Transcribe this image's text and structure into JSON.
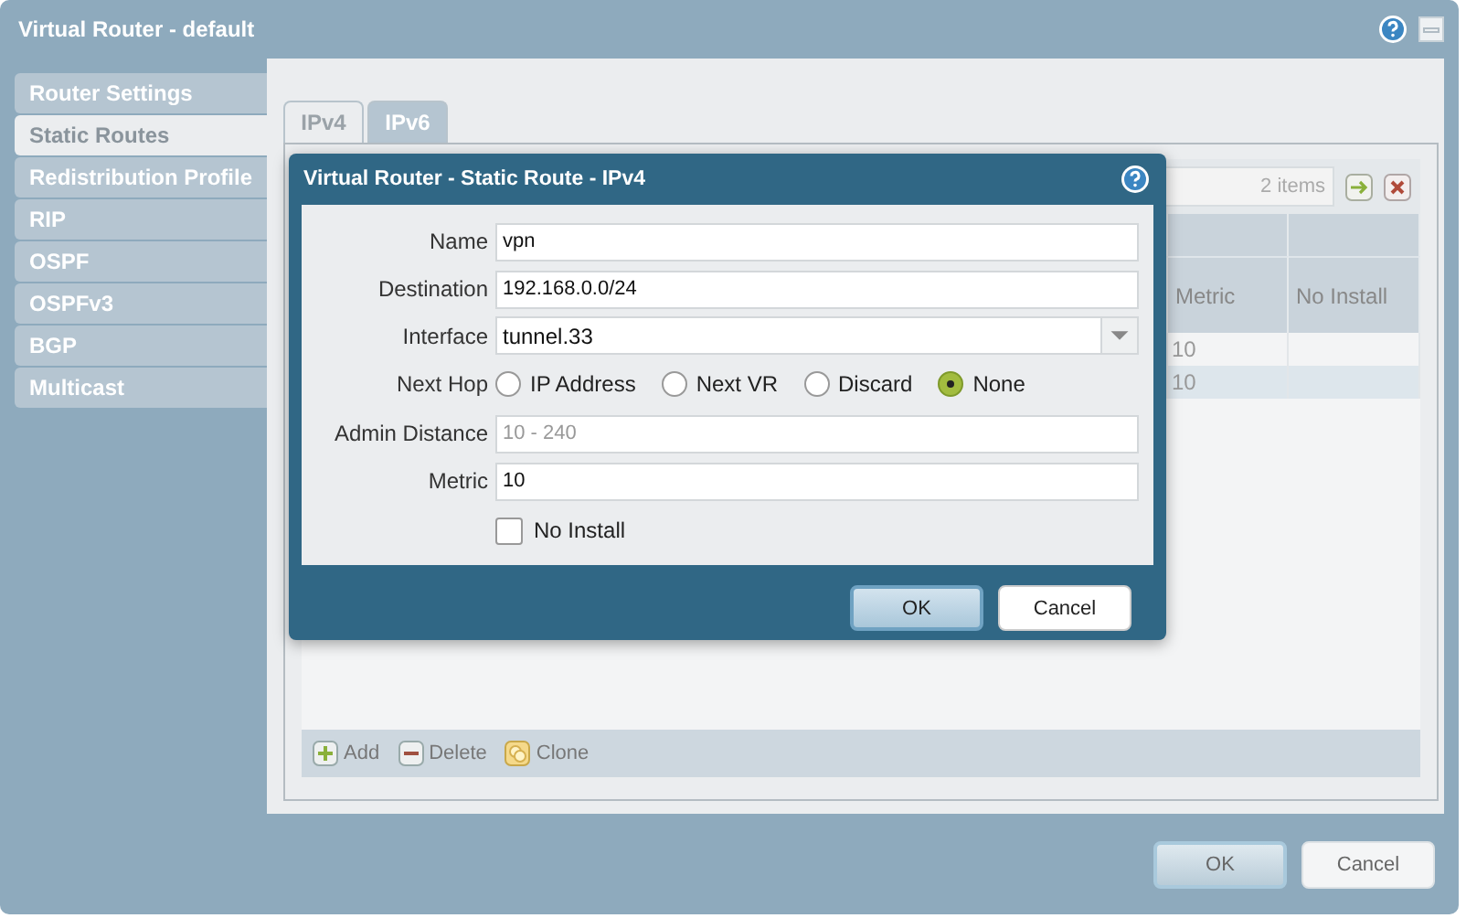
{
  "window": {
    "title": "Virtual Router - default"
  },
  "sidebar": {
    "items": [
      {
        "label": "Router Settings",
        "selected": false
      },
      {
        "label": "Static Routes",
        "selected": true
      },
      {
        "label": "Redistribution Profile",
        "selected": false
      },
      {
        "label": "RIP",
        "selected": false
      },
      {
        "label": "OSPF",
        "selected": false
      },
      {
        "label": "OSPFv3",
        "selected": false
      },
      {
        "label": "BGP",
        "selected": false
      },
      {
        "label": "Multicast",
        "selected": false
      }
    ]
  },
  "tabs": [
    {
      "label": "IPv4",
      "selected": true
    },
    {
      "label": "IPv6",
      "selected": false
    }
  ],
  "table": {
    "count": "2 items",
    "columns": [
      "Metric",
      "No Install"
    ],
    "rows": [
      {
        "metric": "10",
        "selected": false
      },
      {
        "metric": "10",
        "selected": true
      }
    ],
    "actions": [
      {
        "kind": "add",
        "label": "Add"
      },
      {
        "kind": "delete",
        "label": "Delete"
      },
      {
        "kind": "clone",
        "label": "Clone"
      }
    ]
  },
  "buttons": [
    {
      "label": "OK",
      "primary": true
    },
    {
      "label": "Cancel",
      "primary": false
    }
  ],
  "dialog": {
    "title": "Virtual Router - Static Route - IPv4",
    "fields": [
      {
        "kind": "text",
        "label": "Name",
        "value": "vpn"
      },
      {
        "kind": "text",
        "label": "Destination",
        "value": "192.168.0.0/24"
      },
      {
        "kind": "select",
        "label": "Interface",
        "value": "tunnel.33"
      },
      {
        "kind": "radio",
        "label": "Next Hop",
        "options": [
          {
            "label": "IP Address",
            "selected": false
          },
          {
            "label": "Next VR",
            "selected": false
          },
          {
            "label": "Discard",
            "selected": false
          },
          {
            "label": "None",
            "selected": true
          }
        ]
      },
      {
        "kind": "text",
        "label": "Admin Distance",
        "placeholder": "10 - 240"
      },
      {
        "kind": "text",
        "label": "Metric",
        "value": "10"
      },
      {
        "kind": "checkbox",
        "label": "No Install",
        "checked": false
      }
    ],
    "buttons": [
      {
        "label": "OK",
        "primary": true
      },
      {
        "label": "Cancel",
        "primary": false
      }
    ]
  }
}
